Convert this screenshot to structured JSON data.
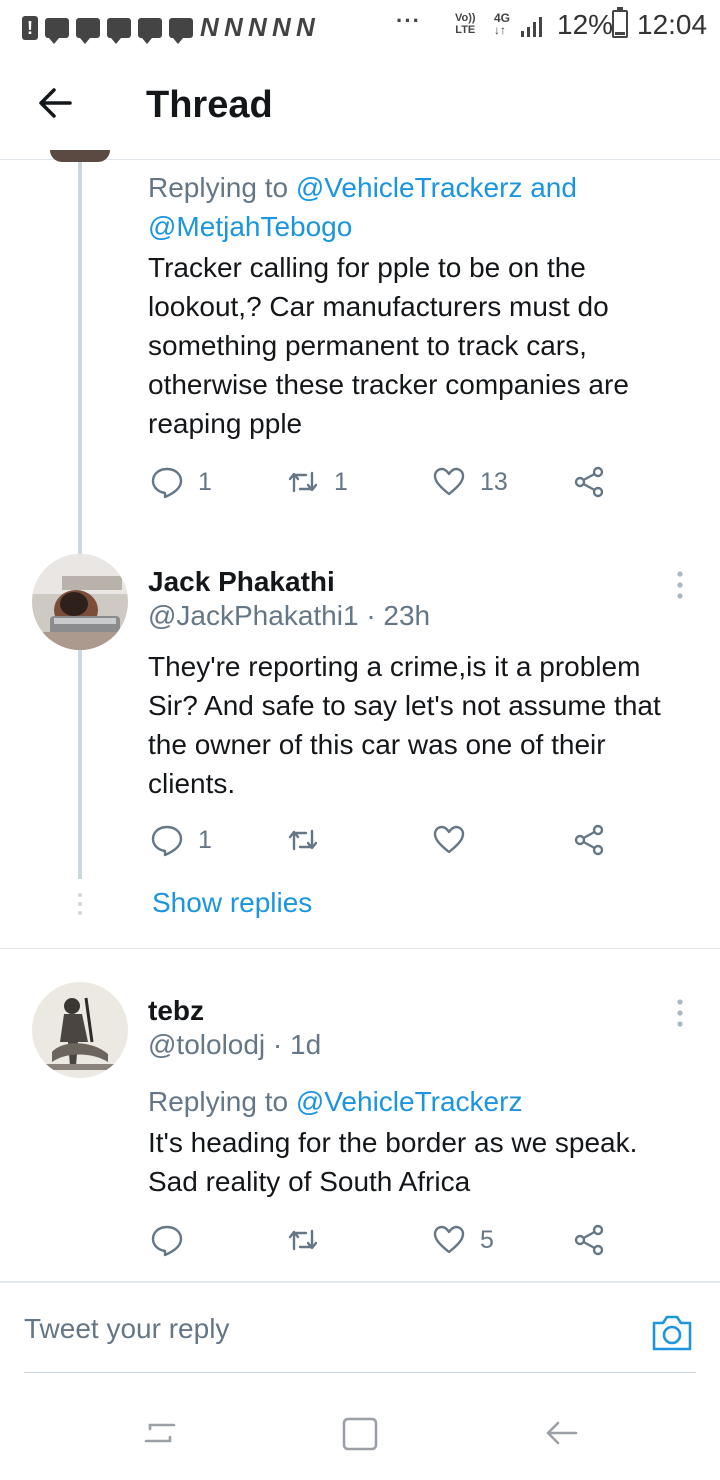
{
  "status_bar": {
    "notif_n_letters": "N N N N N",
    "more": "···",
    "volte": "Vo)) LTE",
    "network": "4G",
    "battery_percent": "12%",
    "time": "12:04"
  },
  "header": {
    "title": "Thread"
  },
  "tweets": [
    {
      "replying_prefix": "Replying to",
      "replying_mentions": "@VehicleTrackerz and @MetjahTebogo",
      "text": "Tracker calling for pple to be on the lookout,? Car manufacturers must do something permanent to track cars, otherwise these tracker companies are reaping pple",
      "replies": "1",
      "retweets": "1",
      "likes": "13"
    },
    {
      "name": "Jack Phakathi",
      "handle_time": "@JackPhakathi1 · 23h",
      "text": "They're reporting a crime,is it a problem Sir? And safe to say let's not assume that the owner of this car was one of their clients.",
      "replies": "1",
      "retweets": "",
      "likes": "",
      "show_replies": "Show replies"
    },
    {
      "name": "tebz",
      "handle_time": "@tololodj · 1d",
      "replying_prefix": "Replying to",
      "replying_mentions": "@VehicleTrackerz",
      "text": "It's heading for the border as we speak. Sad reality of South Africa",
      "replies": "",
      "retweets": "",
      "likes": "5"
    }
  ],
  "reply_bar": {
    "placeholder": "Tweet your reply"
  },
  "icons": {
    "back": "arrow-left-icon",
    "reply": "speech-bubble-icon",
    "retweet": "retweet-icon",
    "like": "heart-icon",
    "share": "share-icon",
    "more": "vertical-dots-icon",
    "camera": "camera-icon"
  },
  "colors": {
    "link": "#1b95e0",
    "secondary_text": "#657786",
    "thread_line": "#ccd6dd",
    "divider": "#e1e8ed"
  }
}
